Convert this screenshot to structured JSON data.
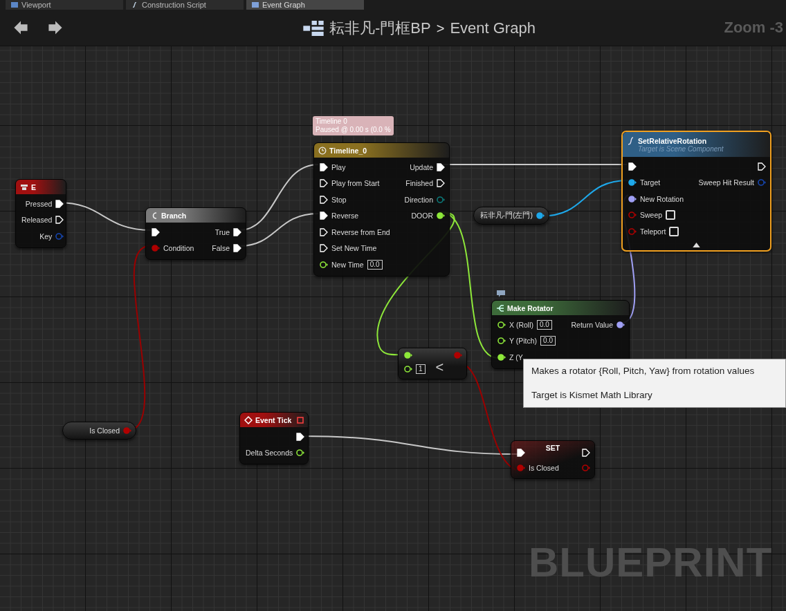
{
  "tabs": [
    {
      "label": "Viewport",
      "kind": "viewport",
      "selected": false
    },
    {
      "label": "Construction Script",
      "kind": "function",
      "selected": false
    },
    {
      "label": "Event Graph",
      "kind": "graph",
      "selected": true
    }
  ],
  "breadcrumb": {
    "blueprint": "耘非凡-門框BP",
    "separator": ">",
    "graph": "Event Graph"
  },
  "zoom": "Zoom -3",
  "nodes": [
    {
      "kind": "input_event",
      "title": "E",
      "color": "#a01010",
      "selected": false,
      "comment_icon": false,
      "outputs": [
        {
          "label": "Pressed",
          "kind": "exec",
          "connected": true
        },
        {
          "label": "Released",
          "kind": "exec",
          "connected": false
        },
        {
          "label": "Key",
          "kind": "data",
          "color": "#1646b0",
          "connected": false
        }
      ]
    },
    {
      "kind": "branch",
      "title": "Branch",
      "color": "#7a7a7a",
      "selected": false,
      "comment_icon": false,
      "inputs": [
        {
          "kind": "exec",
          "connected": true
        },
        {
          "label": "Condition",
          "kind": "data",
          "color": "#b00000",
          "connected": true
        }
      ],
      "outputs": [
        {
          "label": "True",
          "kind": "exec",
          "connected": true
        },
        {
          "label": "False",
          "kind": "exec",
          "connected": true
        }
      ]
    },
    {
      "kind": "timeline",
      "title": "Timeline_0",
      "color": "#8a7020",
      "selected": false,
      "comment_icon": false,
      "comment": [
        "Timeline 0",
        "Paused @ 0.00 s (0.0 %"
      ],
      "inputs": [
        {
          "label": "Play",
          "kind": "exec",
          "connected": true
        },
        {
          "label": "Play from Start",
          "kind": "exec",
          "connected": false
        },
        {
          "label": "Stop",
          "kind": "exec",
          "connected": false
        },
        {
          "label": "Reverse",
          "kind": "exec",
          "connected": true
        },
        {
          "label": "Reverse from End",
          "kind": "exec",
          "connected": false
        },
        {
          "label": "Set New Time",
          "kind": "exec",
          "connected": false
        },
        {
          "label": "New Time",
          "kind": "data",
          "color": "#8ee83a",
          "connected": false,
          "value": "0.0"
        }
      ],
      "outputs": [
        {
          "label": "Update",
          "kind": "exec",
          "connected": true
        },
        {
          "label": "Finished",
          "kind": "exec",
          "connected": false
        },
        {
          "label": "Direction",
          "kind": "data",
          "color": "#0c7a7a",
          "connected": false
        },
        {
          "label": "DOOR",
          "kind": "data",
          "color": "#8ee83a",
          "connected": true
        }
      ]
    },
    {
      "kind": "getter",
      "selected": false,
      "comment_icon": false,
      "outputs": [
        {
          "label": "耘非凡-門(左門)",
          "kind": "data",
          "color": "#1ea8ea",
          "connected": true
        }
      ]
    },
    {
      "kind": "function_call",
      "title": "SetRelativeRotation",
      "subtitle": "Target is Scene Component",
      "color": "#2f5f86",
      "selected": true,
      "comment_icon": false,
      "advanced_expanded": true,
      "inputs": [
        {
          "kind": "exec",
          "connected": true
        },
        {
          "label": "Target",
          "kind": "data",
          "color": "#1ea8ea",
          "connected": true
        },
        {
          "label": "New Rotation",
          "kind": "data",
          "color": "#a0a0f5",
          "connected": true
        },
        {
          "label": "Sweep",
          "kind": "data",
          "color": "#b00000",
          "connected": false,
          "checked": false
        },
        {
          "label": "Teleport",
          "kind": "data",
          "color": "#b00000",
          "connected": false,
          "checked": false
        }
      ],
      "outputs": [
        {
          "kind": "exec",
          "connected": false
        },
        {
          "label": "Sweep Hit Result",
          "kind": "data",
          "color": "#1646b0",
          "connected": false
        }
      ]
    },
    {
      "kind": "pure_function",
      "title": "Make Rotator",
      "color": "#3d6b3a",
      "selected": false,
      "comment_icon": true,
      "inputs": [
        {
          "label": "X (Roll)",
          "kind": "data",
          "color": "#8ee83a",
          "connected": false,
          "value": "0.0"
        },
        {
          "label": "Y (Pitch)",
          "kind": "data",
          "color": "#8ee83a",
          "connected": false,
          "value": "0.0"
        },
        {
          "label": "Z (Y",
          "kind": "data",
          "color": "#8ee83a",
          "connected": true
        }
      ],
      "outputs": [
        {
          "label": "Return Value",
          "kind": "data",
          "color": "#a0a0f5",
          "connected": true
        }
      ]
    },
    {
      "kind": "compare",
      "symbol": "<",
      "selected": false,
      "comment_icon": false,
      "inputs": [
        {
          "kind": "data",
          "color": "#8ee83a",
          "connected": true
        },
        {
          "kind": "data",
          "color": "#8ee83a",
          "connected": false,
          "value": "1"
        }
      ],
      "outputs": [
        {
          "kind": "data",
          "color": "#b00000",
          "connected": true
        }
      ]
    },
    {
      "kind": "getter",
      "selected": false,
      "comment_icon": false,
      "outputs": [
        {
          "label": "Is Closed",
          "kind": "data",
          "color": "#b00000",
          "connected": true
        }
      ]
    },
    {
      "kind": "event",
      "title": "Event Tick",
      "color": "#a01010",
      "selected": false,
      "comment_icon": false,
      "outputs": [
        {
          "kind": "exec",
          "connected": true
        },
        {
          "label": "Delta Seconds",
          "kind": "data",
          "color": "#8ee83a",
          "connected": false
        }
      ]
    },
    {
      "kind": "set",
      "title": "SET",
      "selected": false,
      "comment_icon": false,
      "inputs": [
        {
          "kind": "exec",
          "connected": true
        },
        {
          "label": "Is Closed",
          "kind": "data",
          "color": "#b00000",
          "connected": true
        }
      ],
      "outputs": [
        {
          "kind": "exec",
          "connected": false
        },
        {
          "kind": "data",
          "color": "#b00000",
          "connected": false
        }
      ]
    }
  ],
  "tooltip": {
    "lines": [
      "Makes a rotator {Roll, Pitch, Yaw} from rotation values",
      "Target is Kismet Math Library"
    ]
  },
  "graph_watermark": "BLUEPRINT"
}
